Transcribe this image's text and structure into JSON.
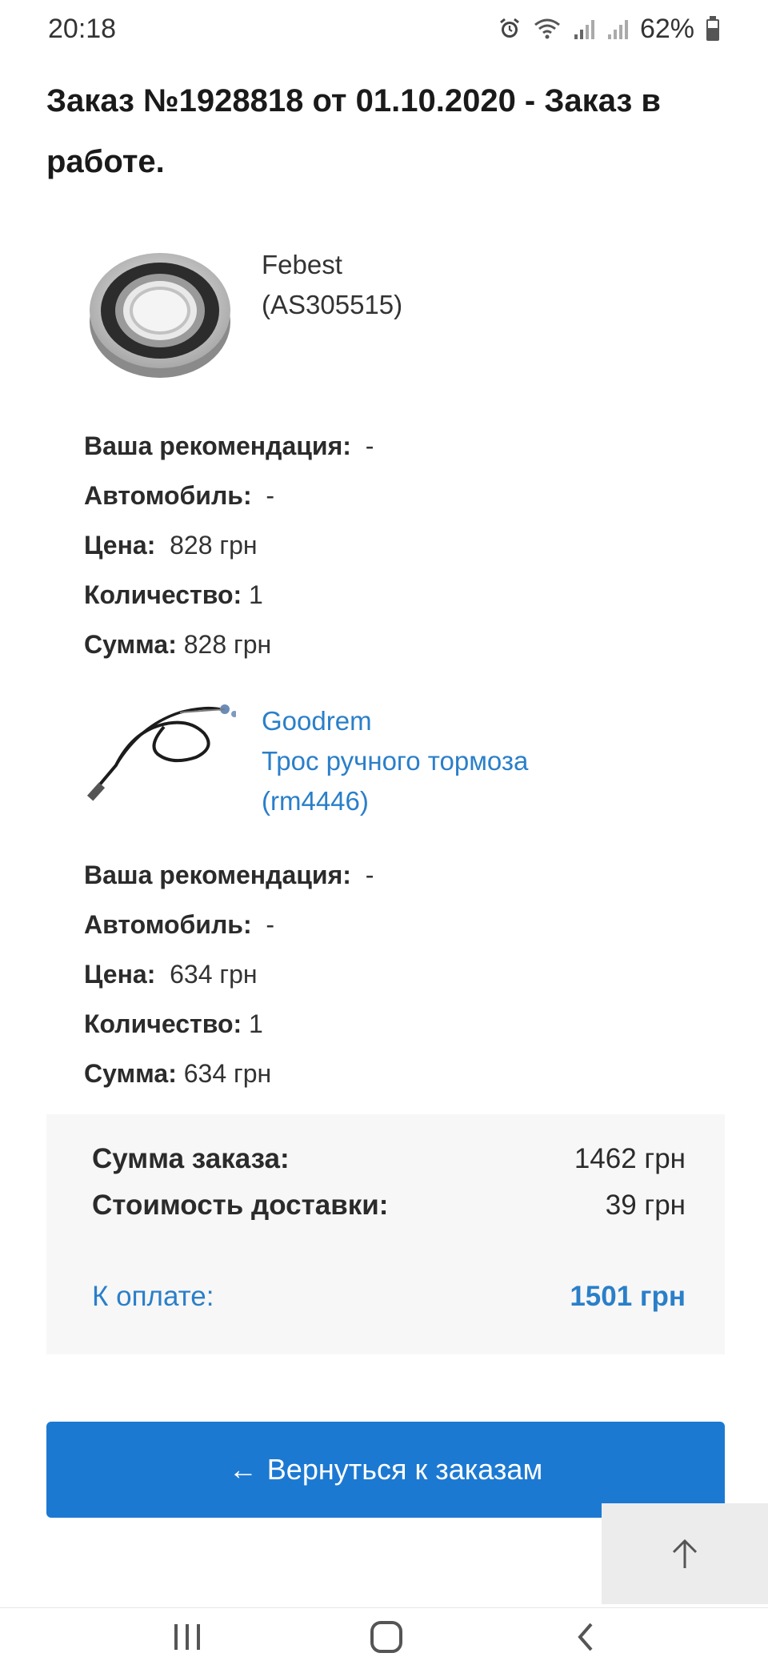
{
  "status_bar": {
    "time": "20:18",
    "battery_percent": "62%",
    "icons": [
      "alarm-icon",
      "wifi-icon",
      "signal-icon",
      "signal-icon-2",
      "battery-icon"
    ]
  },
  "order": {
    "title": "Заказ №1928818 от 01.10.2020 - Заказ в работе."
  },
  "labels": {
    "recommendation": "Ваша рекомендация:",
    "car": "Автомобиль:",
    "price": "Цена:",
    "quantity": "Количество:",
    "sum": "Сумма:"
  },
  "products": [
    {
      "brand": "Febest",
      "name": "",
      "code": "(AS305515)",
      "image": "bearing-image",
      "recommendation": "-",
      "car": "-",
      "price": "828 грн",
      "quantity": "1",
      "sum": "828 грн"
    },
    {
      "brand": "Goodrem",
      "name": "Трос ручного тормоза",
      "code": "(rm4446)",
      "image": "brake-cable-image",
      "recommendation": "-",
      "car": "-",
      "price": "634 грн",
      "quantity": "1",
      "sum": "634 грн"
    }
  ],
  "summary": {
    "order_sum_label": "Сумма заказа:",
    "order_sum_value": "1462 грн",
    "delivery_label": "Стоимость доставки:",
    "delivery_value": "39 грн",
    "to_pay_label": "К оплате:",
    "to_pay_value": "1501 грн"
  },
  "actions": {
    "back_arrow": "←",
    "back_label": "Вернуться к заказам"
  },
  "colors": {
    "accent": "#1c79d2",
    "link": "#2a7fc9",
    "summary_bg": "#f7f7f7"
  }
}
